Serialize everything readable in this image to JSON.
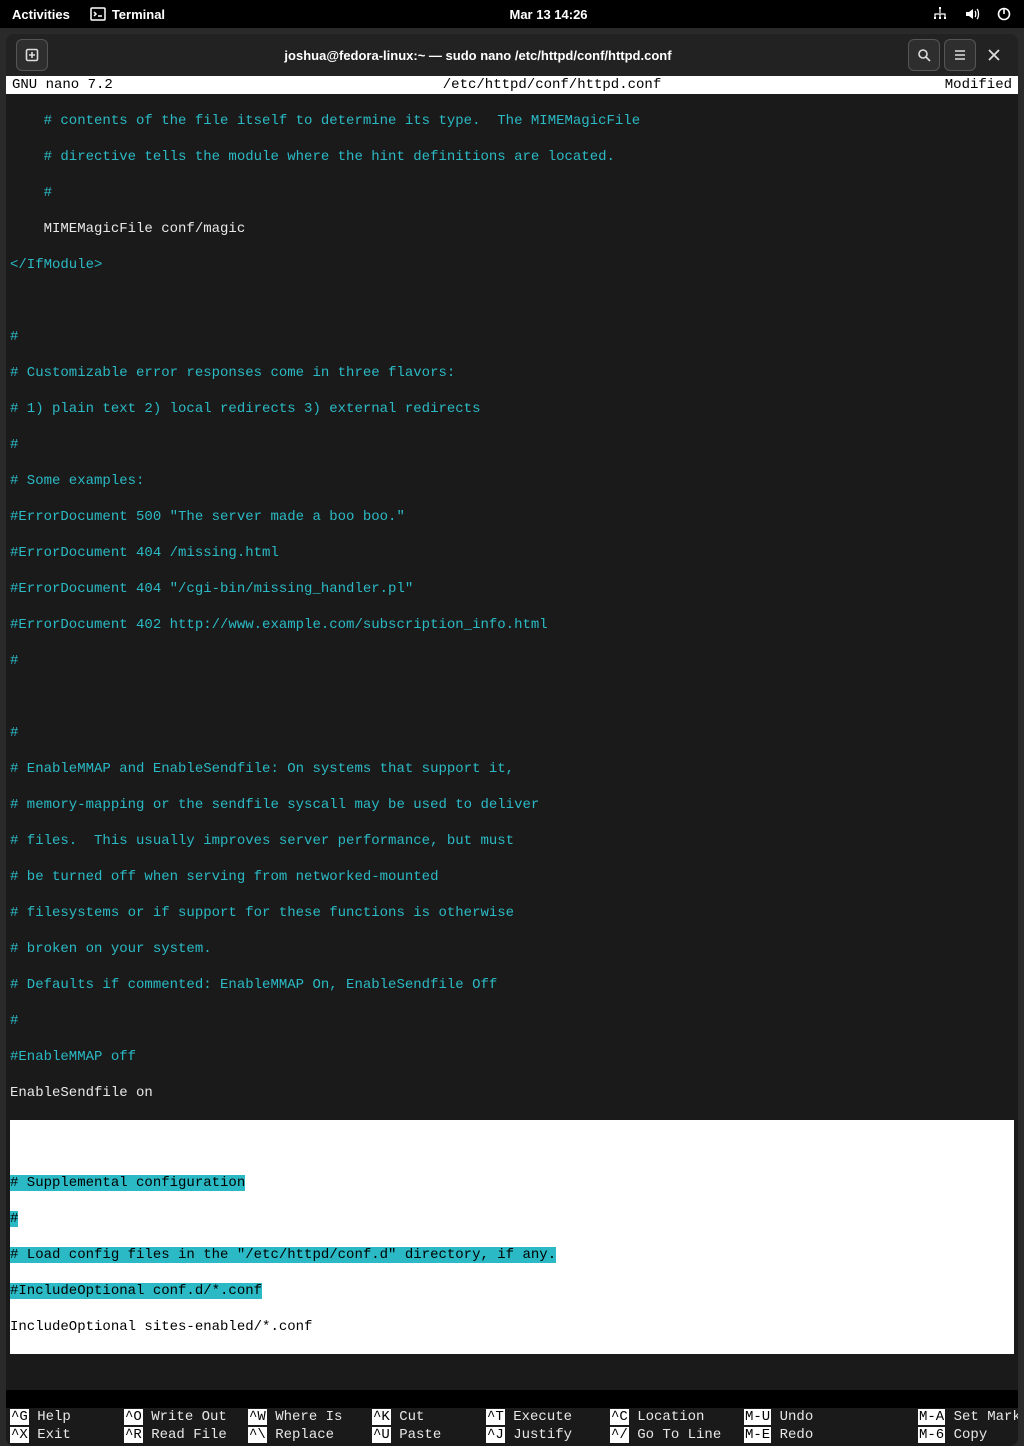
{
  "topbar": {
    "activities": "Activities",
    "app_name": "Terminal",
    "datetime": "Mar 13  14:26"
  },
  "window": {
    "title": "joshua@fedora-linux:~ — sudo nano /etc/httpd/conf/httpd.conf"
  },
  "nano": {
    "version": "GNU nano 7.2",
    "filepath": "/etc/httpd/conf/httpd.conf",
    "status": "Modified"
  },
  "lines": {
    "l01": "    # contents of the file itself to determine its type.  The MIMEMagicFile",
    "l02": "    # directive tells the module where the hint definitions are located.",
    "l03": "    #",
    "l04": "    MIMEMagicFile conf/magic",
    "l05": "</IfModule>",
    "l06": "#",
    "l07": "# Customizable error responses come in three flavors:",
    "l08": "# 1) plain text 2) local redirects 3) external redirects",
    "l09": "#",
    "l10": "# Some examples:",
    "l11": "#ErrorDocument 500 \"The server made a boo boo.\"",
    "l12": "#ErrorDocument 404 /missing.html",
    "l13": "#ErrorDocument 404 \"/cgi-bin/missing_handler.pl\"",
    "l14": "#ErrorDocument 402 http://www.example.com/subscription_info.html",
    "l15": "#",
    "l16": "#",
    "l17": "# EnableMMAP and EnableSendfile: On systems that support it,",
    "l18": "# memory-mapping or the sendfile syscall may be used to deliver",
    "l19": "# files.  This usually improves server performance, but must",
    "l20": "# be turned off when serving from networked-mounted",
    "l21": "# filesystems or if support for these functions is otherwise",
    "l22": "# broken on your system.",
    "l23": "# Defaults if commented: EnableMMAP On, EnableSendfile Off",
    "l24": "#",
    "l25": "#EnableMMAP off",
    "l26": "EnableSendfile on",
    "l27": "# Supplemental configuration",
    "l28": "#",
    "l29": "# Load config files in the \"/etc/httpd/conf.d\" directory, if any.",
    "l30": "#IncludeOptional conf.d/*.conf",
    "l31": "IncludeOptional sites-enabled/*.conf"
  },
  "shortcuts": {
    "r1c1k": "^G",
    "r1c1l": "Help",
    "r1c2k": "^O",
    "r1c2l": "Write Out",
    "r1c3k": "^W",
    "r1c3l": "Where Is",
    "r1c4k": "^K",
    "r1c4l": "Cut",
    "r1c5k": "^T",
    "r1c5l": "Execute",
    "r1c6k": "^C",
    "r1c6l": "Location",
    "r1c7ak": "M-U",
    "r1c7al": "Undo",
    "r1c8ak": "M-A",
    "r1c8al": "Set Mark",
    "r2c1k": "^X",
    "r2c1l": "Exit",
    "r2c2k": "^R",
    "r2c2l": "Read File",
    "r2c3k": "^\\",
    "r2c3l": "Replace",
    "r2c4k": "^U",
    "r2c4l": "Paste",
    "r2c5k": "^J",
    "r2c5l": "Justify",
    "r2c6k": "^/",
    "r2c6l": "Go To Line",
    "r2c7ak": "M-E",
    "r2c7al": "Redo",
    "r2c8ak": "M-6",
    "r2c8al": "Copy"
  }
}
